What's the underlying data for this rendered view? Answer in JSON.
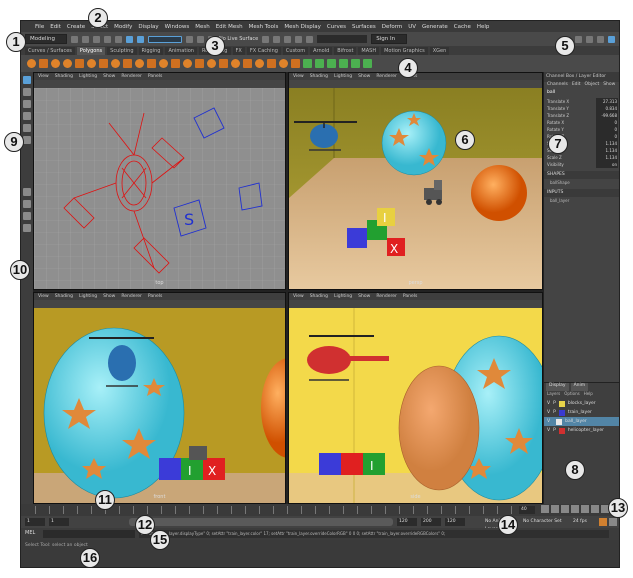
{
  "menubar": {
    "items": [
      "File",
      "Edit",
      "Create",
      "Select",
      "Modify",
      "Display",
      "Windows",
      "Mesh",
      "Edit Mesh",
      "Mesh Tools",
      "Mesh Display",
      "Curves",
      "Surfaces",
      "Deform",
      "UV",
      "Generate",
      "Cache",
      "Help"
    ]
  },
  "status_line": {
    "mode": "Modeling",
    "live_surface": "No Live Surface",
    "camera_select": "Sign In"
  },
  "shelf": {
    "tabs": [
      "Curves / Surfaces",
      "Polygons",
      "Sculpting",
      "Rigging",
      "Animation",
      "Rendering",
      "FX",
      "FX Caching",
      "Custom",
      "Arnold",
      "Bifrost",
      "MASH",
      "Motion Graphics",
      "XGen"
    ],
    "active_tab": "Polygons"
  },
  "viewports": {
    "menu": [
      "View",
      "Shading",
      "Lighting",
      "Show",
      "Renderer",
      "Panels"
    ],
    "top_label": "top",
    "persp_label": "persp",
    "front_label": "front",
    "side_label": "side"
  },
  "channel_box": {
    "title": "Channel Box / Layer Editor",
    "menu": [
      "Channels",
      "Edit",
      "Object",
      "Show"
    ],
    "object": "ball",
    "attributes": [
      {
        "name": "Translate X",
        "value": "27.313"
      },
      {
        "name": "Translate Y",
        "value": "0.834"
      },
      {
        "name": "Translate Z",
        "value": "-99.668"
      },
      {
        "name": "Rotate X",
        "value": "0"
      },
      {
        "name": "Rotate Y",
        "value": "0"
      },
      {
        "name": "Rotate Z",
        "value": "0"
      },
      {
        "name": "Scale X",
        "value": "1.134"
      },
      {
        "name": "Scale Y",
        "value": "1.134"
      },
      {
        "name": "Scale Z",
        "value": "1.134"
      },
      {
        "name": "Visibility",
        "value": "on"
      }
    ],
    "shapes_label": "SHAPES",
    "shape_name": "ballShape",
    "inputs_label": "INPUTS",
    "input_name": "ball_layer"
  },
  "layer_editor": {
    "tabs": [
      "Display",
      "Anim"
    ],
    "menu": [
      "Layers",
      "Options",
      "Help"
    ],
    "layers": [
      {
        "v": "V",
        "p": "P",
        "name": "blocks_layer",
        "color": "#e8d44a"
      },
      {
        "v": "V",
        "p": "P",
        "name": "train_layer",
        "color": "#3a3ad0"
      },
      {
        "v": "V",
        "p": "",
        "name": "ball_layer",
        "color": "#e8e8e8"
      },
      {
        "v": "V",
        "p": "P",
        "name": "helicopter_layer",
        "color": "#d03030"
      }
    ]
  },
  "time_slider": {
    "current_frame": "40",
    "end_frame": "200"
  },
  "range_slider": {
    "start": "1",
    "start_inner": "1",
    "end_inner": "120",
    "end": "200",
    "playback_end": "120",
    "anim_layer": "No Anim Layer",
    "char_set": "No Character Set",
    "fps": "24 fps"
  },
  "command_line": {
    "label": "MEL",
    "result": "setAttr \"train_layer.displayType\" 0; setAttr \"train_layer.color\" 17; setAttr \"train_layer.overrideColorRGB\" 0 0 0; setAttr \"train_layer.overrideRGBColors\" 0;"
  },
  "help_line": {
    "text": "Select Tool: select an object"
  },
  "callouts": [
    "1",
    "2",
    "3",
    "4",
    "5",
    "6",
    "7",
    "8",
    "9",
    "10",
    "11",
    "12",
    "13",
    "14",
    "15",
    "16"
  ]
}
